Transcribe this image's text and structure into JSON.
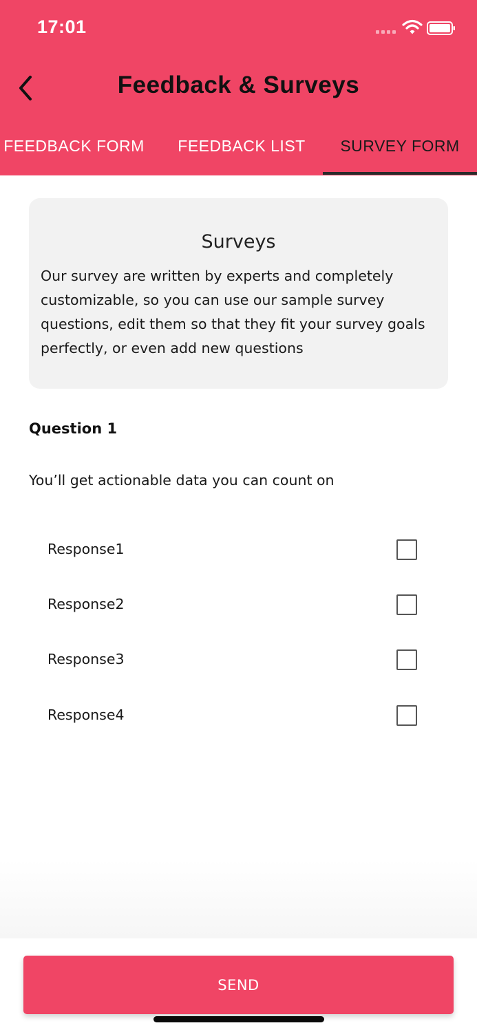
{
  "status_bar": {
    "time": "17:01"
  },
  "header": {
    "title": "Feedback & Surveys",
    "back_icon": "chevron-left-icon"
  },
  "tabs": [
    {
      "label": "FEEDBACK FORM",
      "active": false
    },
    {
      "label": "FEEDBACK LIST",
      "active": false
    },
    {
      "label": "SURVEY FORM",
      "active": true
    }
  ],
  "info_card": {
    "title": "Surveys",
    "body": "Our survey are written by experts and completely customizable, so you can use our sample survey questions, edit them so that they fit your survey goals perfectly, or even add new questions"
  },
  "question": {
    "label": "Question 1",
    "text": "You’ll get actionable data you can count on"
  },
  "responses": [
    {
      "label": "Response1",
      "checked": false
    },
    {
      "label": "Response2",
      "checked": false
    },
    {
      "label": "Response3",
      "checked": false
    },
    {
      "label": "Response4",
      "checked": false
    }
  ],
  "send_button": {
    "label": "SEND"
  },
  "colors": {
    "accent": "#f04565",
    "card_background": "#f2f2f2",
    "active_tab_text": "#1a1a1a"
  }
}
